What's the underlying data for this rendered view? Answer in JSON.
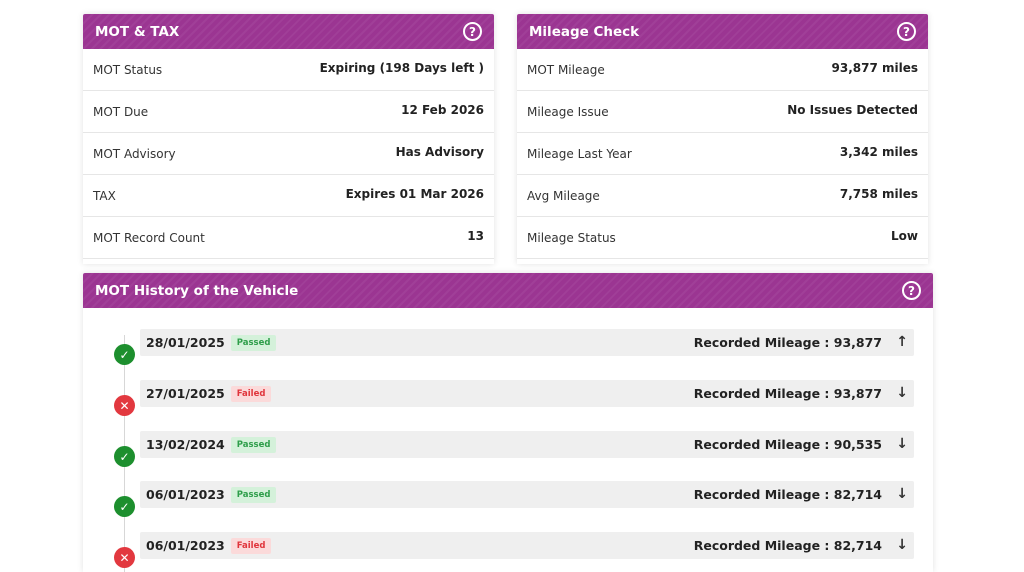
{
  "mot_tax": {
    "title": "MOT & TAX",
    "rows": [
      {
        "label": "MOT Status",
        "value": "Expiring (198 Days left )"
      },
      {
        "label": "MOT Due",
        "value": "12 Feb 2026"
      },
      {
        "label": "MOT Advisory",
        "value": "Has Advisory"
      },
      {
        "label": "TAX",
        "value": "Expires 01 Mar 2026"
      },
      {
        "label": "MOT Record Count",
        "value": "13"
      }
    ]
  },
  "mileage_check": {
    "title": "Mileage Check",
    "rows": [
      {
        "label": "MOT Mileage",
        "value": "93,877 miles"
      },
      {
        "label": "Mileage Issue",
        "value": "No Issues Detected"
      },
      {
        "label": "Mileage Last Year",
        "value": "3,342 miles"
      },
      {
        "label": "Avg Mileage",
        "value": "7,758 miles"
      },
      {
        "label": "Mileage Status",
        "value": "Low"
      }
    ]
  },
  "history": {
    "title": "MOT History of the Vehicle",
    "entries": [
      {
        "date": "28/01/2025",
        "status": "Passed",
        "mileage": "Recorded Mileage : 93,877",
        "arrow": "↑"
      },
      {
        "date": "27/01/2025",
        "status": "Failed",
        "mileage": "Recorded Mileage : 93,877",
        "arrow": "↓"
      },
      {
        "date": "13/02/2024",
        "status": "Passed",
        "mileage": "Recorded Mileage : 90,535",
        "arrow": "↓"
      },
      {
        "date": "06/01/2023",
        "status": "Passed",
        "mileage": "Recorded Mileage : 82,714",
        "arrow": "↓"
      },
      {
        "date": "06/01/2023",
        "status": "Failed",
        "mileage": "Recorded Mileage : 82,714",
        "arrow": "↓"
      }
    ]
  },
  "icons": {
    "help": "?",
    "pass": "✓",
    "fail": "✕"
  },
  "colors": {
    "header": "#9b3592",
    "pass": "#1d8f2e",
    "fail": "#e2383f"
  }
}
